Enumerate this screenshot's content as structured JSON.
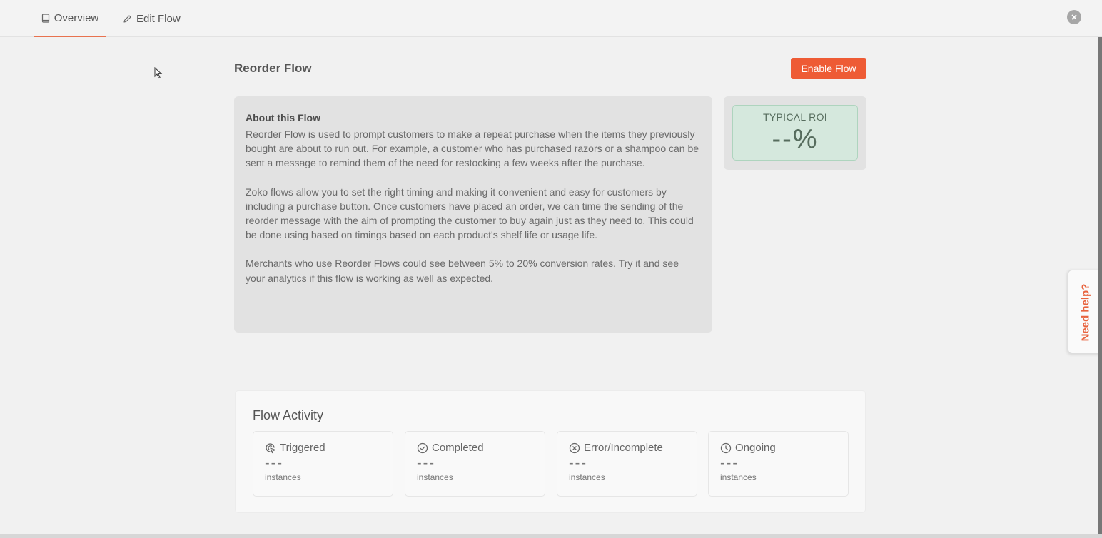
{
  "tabs": [
    {
      "label": "Overview",
      "icon": "book-icon",
      "active": true
    },
    {
      "label": "Edit Flow",
      "icon": "pencil-icon",
      "active": false
    }
  ],
  "page": {
    "title": "Reorder Flow",
    "enable_button": "Enable Flow"
  },
  "about": {
    "heading": "About this Flow",
    "paragraphs": [
      "Reorder Flow is used to prompt customers to make a repeat purchase when the items they previously bought are about to run out. For example, a customer who has purchased razors or a shampoo can be sent a message to remind them of the need for restocking a few weeks after the purchase.",
      "Zoko flows allow you to set the right timing and making it convenient and easy for customers by including a purchase button. Once customers have placed an order, we can time the sending of the reorder message with the aim of prompting the customer to buy again just as they need to. This could be done using based on timings based on each product's shelf life or usage life.",
      "Merchants who use Reorder Flows could see between 5% to 20% conversion rates. Try it and see your analytics if this flow is working as well as expected."
    ]
  },
  "roi": {
    "label": "TYPICAL ROI",
    "value": "--%"
  },
  "activity": {
    "title": "Flow Activity",
    "cards": [
      {
        "label": "Triggered",
        "icon": "cursor-click-icon",
        "value": "---",
        "unit": "instances"
      },
      {
        "label": "Completed",
        "icon": "check-circle-icon",
        "value": "---",
        "unit": "instances"
      },
      {
        "label": "Error/Incomplete",
        "icon": "x-circle-icon",
        "value": "---",
        "unit": "instances"
      },
      {
        "label": "Ongoing",
        "icon": "clock-icon",
        "value": "---",
        "unit": "instances"
      }
    ]
  },
  "help": {
    "label": "Need help?"
  },
  "colors": {
    "accent": "#ee5b35",
    "roi_bg": "#d5e8dd",
    "help_text": "#e8643f"
  }
}
